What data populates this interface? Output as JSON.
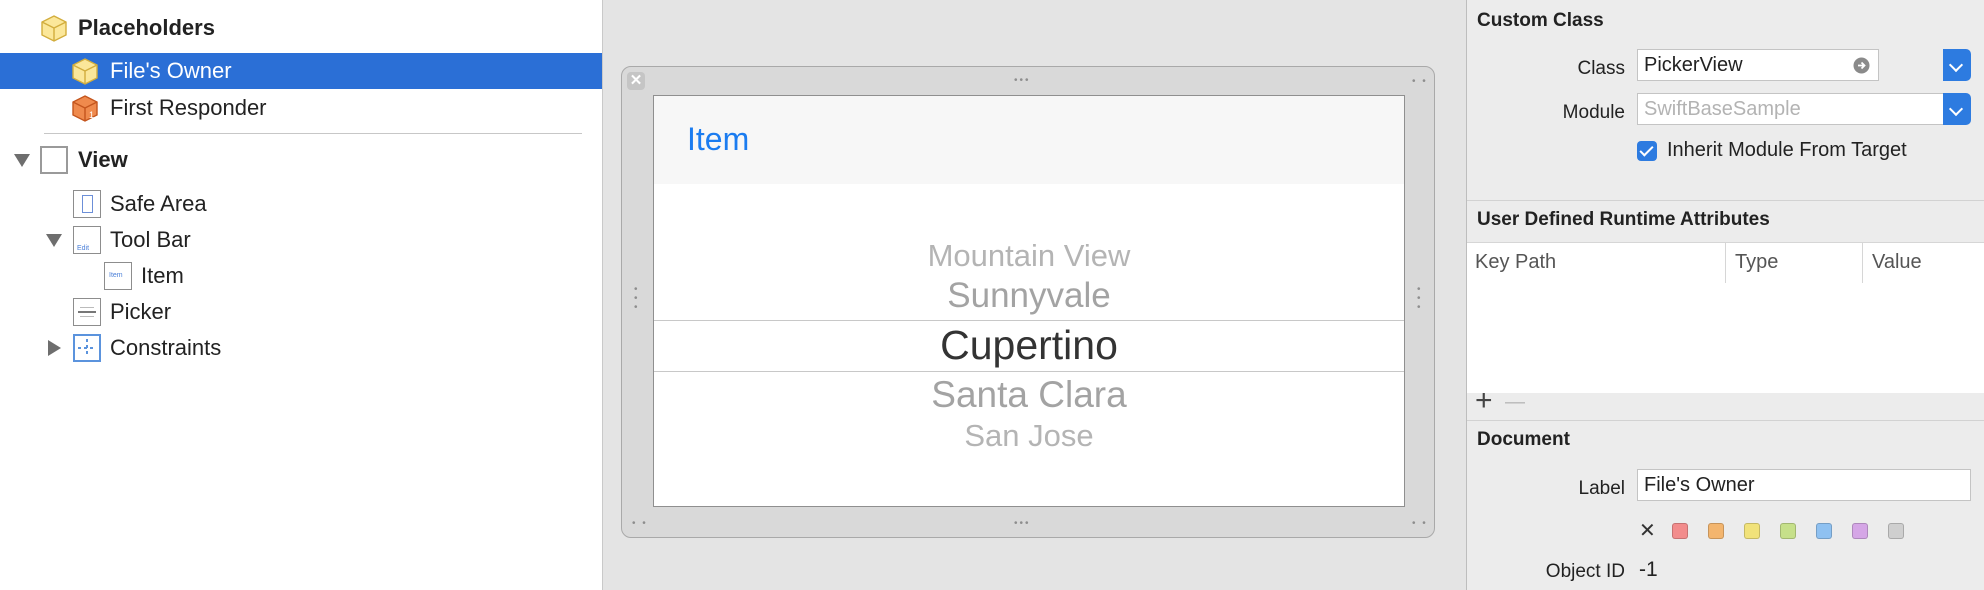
{
  "outline": {
    "placeholders_label": "Placeholders",
    "files_owner_label": "File's Owner",
    "first_responder_label": "First Responder",
    "first_responder_badge": "1",
    "view_label": "View",
    "safe_area_label": "Safe Area",
    "toolbar_label": "Tool Bar",
    "toolbar_icon_text": "Edit",
    "item_label": "Item",
    "item_icon_text": "Item",
    "picker_label": "Picker",
    "constraints_label": "Constraints"
  },
  "canvas": {
    "close_glyph": "✕",
    "toolbar_item": "Item",
    "picker_rows": [
      "Mountain View",
      "Sunnyvale",
      "Cupertino",
      "Santa Clara",
      "San Jose"
    ]
  },
  "inspector": {
    "custom_class": {
      "title": "Custom Class",
      "class_label": "Class",
      "class_value": "PickerView",
      "module_label": "Module",
      "module_placeholder": "SwiftBaseSample",
      "inherit_checked": true,
      "inherit_label": "Inherit Module From Target"
    },
    "runtime_attributes": {
      "title": "User Defined Runtime Attributes",
      "columns": [
        "Key Path",
        "Type",
        "Value"
      ],
      "add_glyph": "+",
      "remove_glyph": "—"
    },
    "document": {
      "title": "Document",
      "label_label": "Label",
      "label_value": "File's Owner",
      "clear_glyph": "✕",
      "label_colors": [
        "#f28c8c",
        "#f3b56e",
        "#f1e27a",
        "#c6e08a",
        "#8fc1f1",
        "#d5a6e6",
        "#cfcfcf"
      ],
      "object_id_label": "Object ID",
      "object_id_value": "-1"
    }
  },
  "colors": {
    "selection": "#2b6fd6",
    "accent": "#1b7cf0",
    "placeholder_cube": "#f5d977",
    "responder_cube": "#e8763a"
  }
}
